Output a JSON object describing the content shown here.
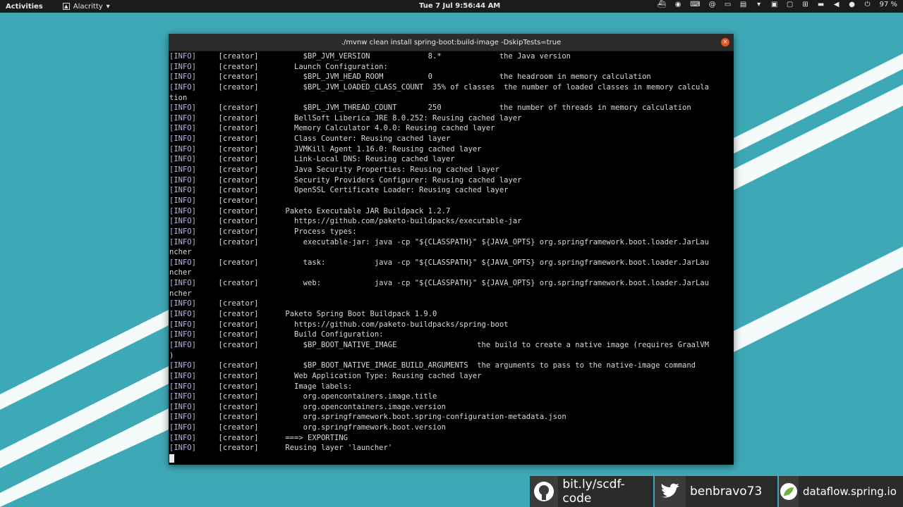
{
  "topbar": {
    "activities": "Activities",
    "app_name": "Alacritty",
    "app_menu_arrow": "▾",
    "clock": "Tue 7 Jul   9:56:44 AM",
    "battery": "97 %",
    "tray_arrow": "▾"
  },
  "window": {
    "title": "./mvnw clean install spring-boot:build-image -DskipTests=true",
    "close_glyph": "×"
  },
  "terminal": {
    "lines": [
      {
        "tag": "[INFO]",
        "src": "[creator]",
        "text": "      $BP_JVM_VERSION             8.*             the Java version"
      },
      {
        "tag": "[INFO]",
        "src": "[creator]",
        "text": "    Launch Configuration:"
      },
      {
        "tag": "[INFO]",
        "src": "[creator]",
        "text": "      $BPL_JVM_HEAD_ROOM          0               the headroom in memory calculation"
      },
      {
        "tag": "[INFO]",
        "src": "[creator]",
        "text": "      $BPL_JVM_LOADED_CLASS_COUNT  35% of classes  the number of loaded classes in memory calcula"
      },
      {
        "tag": "",
        "src": "",
        "text": "tion"
      },
      {
        "tag": "[INFO]",
        "src": "[creator]",
        "text": "      $BPL_JVM_THREAD_COUNT       250             the number of threads in memory calculation"
      },
      {
        "tag": "[INFO]",
        "src": "[creator]",
        "text": "    BellSoft Liberica JRE 8.0.252: Reusing cached layer"
      },
      {
        "tag": "[INFO]",
        "src": "[creator]",
        "text": "    Memory Calculator 4.0.0: Reusing cached layer"
      },
      {
        "tag": "[INFO]",
        "src": "[creator]",
        "text": "    Class Counter: Reusing cached layer"
      },
      {
        "tag": "[INFO]",
        "src": "[creator]",
        "text": "    JVMKill Agent 1.16.0: Reusing cached layer"
      },
      {
        "tag": "[INFO]",
        "src": "[creator]",
        "text": "    Link-Local DNS: Reusing cached layer"
      },
      {
        "tag": "[INFO]",
        "src": "[creator]",
        "text": "    Java Security Properties: Reusing cached layer"
      },
      {
        "tag": "[INFO]",
        "src": "[creator]",
        "text": "    Security Providers Configurer: Reusing cached layer"
      },
      {
        "tag": "[INFO]",
        "src": "[creator]",
        "text": "    OpenSSL Certificate Loader: Reusing cached layer"
      },
      {
        "tag": "[INFO]",
        "src": "[creator]",
        "text": ""
      },
      {
        "tag": "[INFO]",
        "src": "[creator]",
        "text": "  Paketo Executable JAR Buildpack 1.2.7"
      },
      {
        "tag": "[INFO]",
        "src": "[creator]",
        "text": "    https://github.com/paketo-buildpacks/executable-jar"
      },
      {
        "tag": "[INFO]",
        "src": "[creator]",
        "text": "    Process types:"
      },
      {
        "tag": "[INFO]",
        "src": "[creator]",
        "text": "      executable-jar: java -cp \"${CLASSPATH}\" ${JAVA_OPTS} org.springframework.boot.loader.JarLau"
      },
      {
        "tag": "",
        "src": "",
        "text": "ncher"
      },
      {
        "tag": "[INFO]",
        "src": "[creator]",
        "text": "      task:           java -cp \"${CLASSPATH}\" ${JAVA_OPTS} org.springframework.boot.loader.JarLau"
      },
      {
        "tag": "",
        "src": "",
        "text": "ncher"
      },
      {
        "tag": "[INFO]",
        "src": "[creator]",
        "text": "      web:            java -cp \"${CLASSPATH}\" ${JAVA_OPTS} org.springframework.boot.loader.JarLau"
      },
      {
        "tag": "",
        "src": "",
        "text": "ncher"
      },
      {
        "tag": "[INFO]",
        "src": "[creator]",
        "text": ""
      },
      {
        "tag": "[INFO]",
        "src": "[creator]",
        "text": "  Paketo Spring Boot Buildpack 1.9.0"
      },
      {
        "tag": "[INFO]",
        "src": "[creator]",
        "text": "    https://github.com/paketo-buildpacks/spring-boot"
      },
      {
        "tag": "[INFO]",
        "src": "[creator]",
        "text": "    Build Configuration:"
      },
      {
        "tag": "[INFO]",
        "src": "[creator]",
        "text": "      $BP_BOOT_NATIVE_IMAGE                  the build to create a native image (requires GraalVM"
      },
      {
        "tag": "",
        "src": "",
        "text": ")"
      },
      {
        "tag": "[INFO]",
        "src": "[creator]",
        "text": "      $BP_BOOT_NATIVE_IMAGE_BUILD_ARGUMENTS  the arguments to pass to the native-image command"
      },
      {
        "tag": "[INFO]",
        "src": "[creator]",
        "text": "    Web Application Type: Reusing cached layer"
      },
      {
        "tag": "[INFO]",
        "src": "[creator]",
        "text": "    Image labels:"
      },
      {
        "tag": "[INFO]",
        "src": "[creator]",
        "text": "      org.opencontainers.image.title"
      },
      {
        "tag": "[INFO]",
        "src": "[creator]",
        "text": "      org.opencontainers.image.version"
      },
      {
        "tag": "[INFO]",
        "src": "[creator]",
        "text": "      org.springframework.boot.spring-configuration-metadata.json"
      },
      {
        "tag": "[INFO]",
        "src": "[creator]",
        "text": "      org.springframework.boot.version"
      },
      {
        "tag": "[INFO]",
        "src": "[creator]",
        "text": "  ===> EXPORTING"
      },
      {
        "tag": "[INFO]",
        "src": "[creator]",
        "text": "  Reusing layer 'launcher'"
      }
    ]
  },
  "footer": {
    "github_text": "bit.ly/scdf-code",
    "twitter_text": "benbravo73",
    "spring_text": "dataflow.spring.io"
  },
  "colors": {
    "wallpaper": "#3ea9b6",
    "stripe": "#ffffff",
    "terminal_bg": "#000000",
    "tag": "#b9b9e8",
    "close": "#e95420"
  }
}
